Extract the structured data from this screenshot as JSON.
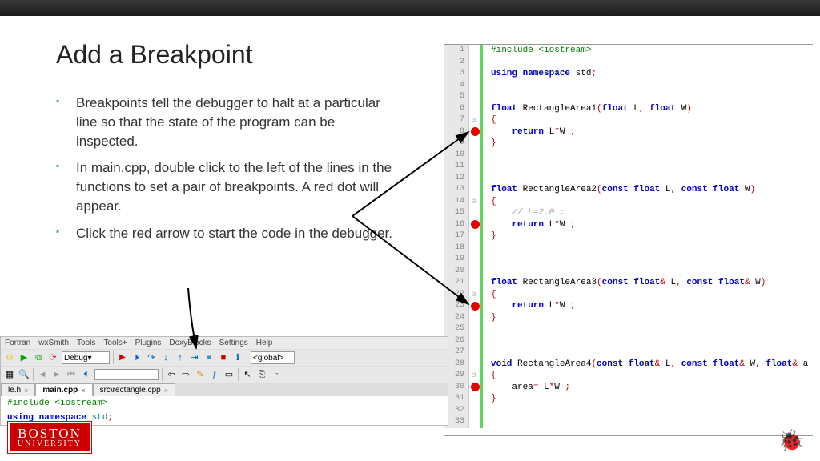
{
  "title": "Add a Breakpoint",
  "bullets": [
    "Breakpoints tell the debugger to halt at a particular line so that the state of the program can be inspected.",
    "In main.cpp, double click to the left of the lines in the functions to set a pair of breakpoints. A red dot will appear.",
    "Click the red arrow to start the code in the debugger."
  ],
  "code": {
    "lines": [
      {
        "n": 1,
        "html": "<span class='pp'>#include &lt;iostream&gt;</span>"
      },
      {
        "n": 2,
        "html": ""
      },
      {
        "n": 3,
        "html": "<span class='kw'>using namespace</span> std<span class='op'>;</span>"
      },
      {
        "n": 4,
        "html": ""
      },
      {
        "n": 5,
        "html": ""
      },
      {
        "n": 6,
        "html": "<span class='kw'>float</span> RectangleArea1<span class='op'>(</span><span class='kw'>float</span> L<span class='op'>,</span> <span class='kw'>float</span> W<span class='op'>)</span>"
      },
      {
        "n": 7,
        "html": "<span class='brace'>{</span>",
        "fold": true
      },
      {
        "n": 8,
        "html": "    <span class='kw'>return</span> L<span class='op'>*</span>W <span class='op'>;</span>",
        "bp": true
      },
      {
        "n": 9,
        "html": "<span class='brace'>}</span>"
      },
      {
        "n": 10,
        "html": ""
      },
      {
        "n": 11,
        "html": ""
      },
      {
        "n": 12,
        "html": ""
      },
      {
        "n": 13,
        "html": "<span class='kw'>float</span> RectangleArea2<span class='op'>(</span><span class='kw'>const float</span> L<span class='op'>,</span> <span class='kw'>const float</span> W<span class='op'>)</span>"
      },
      {
        "n": 14,
        "html": "<span class='brace'>{</span>",
        "fold": true
      },
      {
        "n": 15,
        "html": "    <span class='cmt'>// L=2.0 ;</span>"
      },
      {
        "n": 16,
        "html": "    <span class='kw'>return</span> L<span class='op'>*</span>W <span class='op'>;</span>",
        "bp": true
      },
      {
        "n": 17,
        "html": "<span class='brace'>}</span>"
      },
      {
        "n": 18,
        "html": ""
      },
      {
        "n": 19,
        "html": ""
      },
      {
        "n": 20,
        "html": ""
      },
      {
        "n": 21,
        "html": "<span class='kw'>float</span> RectangleArea3<span class='op'>(</span><span class='kw'>const float</span><span class='op'>&amp;</span> L<span class='op'>,</span> <span class='kw'>const float</span><span class='op'>&amp;</span> W<span class='op'>)</span>"
      },
      {
        "n": 22,
        "html": "<span class='brace'>{</span>",
        "fold": true
      },
      {
        "n": 23,
        "html": "    <span class='kw'>return</span> L<span class='op'>*</span>W <span class='op'>;</span>",
        "bp": true
      },
      {
        "n": 24,
        "html": "<span class='brace'>}</span>"
      },
      {
        "n": 25,
        "html": ""
      },
      {
        "n": 26,
        "html": ""
      },
      {
        "n": 27,
        "html": ""
      },
      {
        "n": 28,
        "html": "<span class='kw'>void</span> RectangleArea4<span class='op'>(</span><span class='kw'>const float</span><span class='op'>&amp;</span> L<span class='op'>,</span> <span class='kw'>const float</span><span class='op'>&amp;</span> W<span class='op'>,</span> <span class='kw'>float</span><span class='op'>&amp;</span> a"
      },
      {
        "n": 29,
        "html": "<span class='brace'>{</span>",
        "fold": true
      },
      {
        "n": 30,
        "html": "    area<span class='op'>=</span> L<span class='op'>*</span>W <span class='op'>;</span>",
        "bp": true
      },
      {
        "n": 31,
        "html": "<span class='brace'>}</span>"
      },
      {
        "n": 32,
        "html": ""
      },
      {
        "n": 33,
        "html": ""
      }
    ]
  },
  "toolbar": {
    "menus": [
      "Fortran",
      "wxSmith",
      "Tools",
      "Tools+",
      "Plugins",
      "DoxyBlocks",
      "Settings",
      "Help"
    ],
    "debug_label": "Debug",
    "global_label": "<global>",
    "tabs": [
      {
        "label": "le.h",
        "active": false
      },
      {
        "label": "main.cpp",
        "active": true
      },
      {
        "label": "src\\rectangle.cpp",
        "active": false
      }
    ],
    "preview1": "#include <iostream>",
    "preview2": "using namespace std;"
  },
  "logo": {
    "line1": "BOSTON",
    "line2": "UNIVERSITY"
  }
}
